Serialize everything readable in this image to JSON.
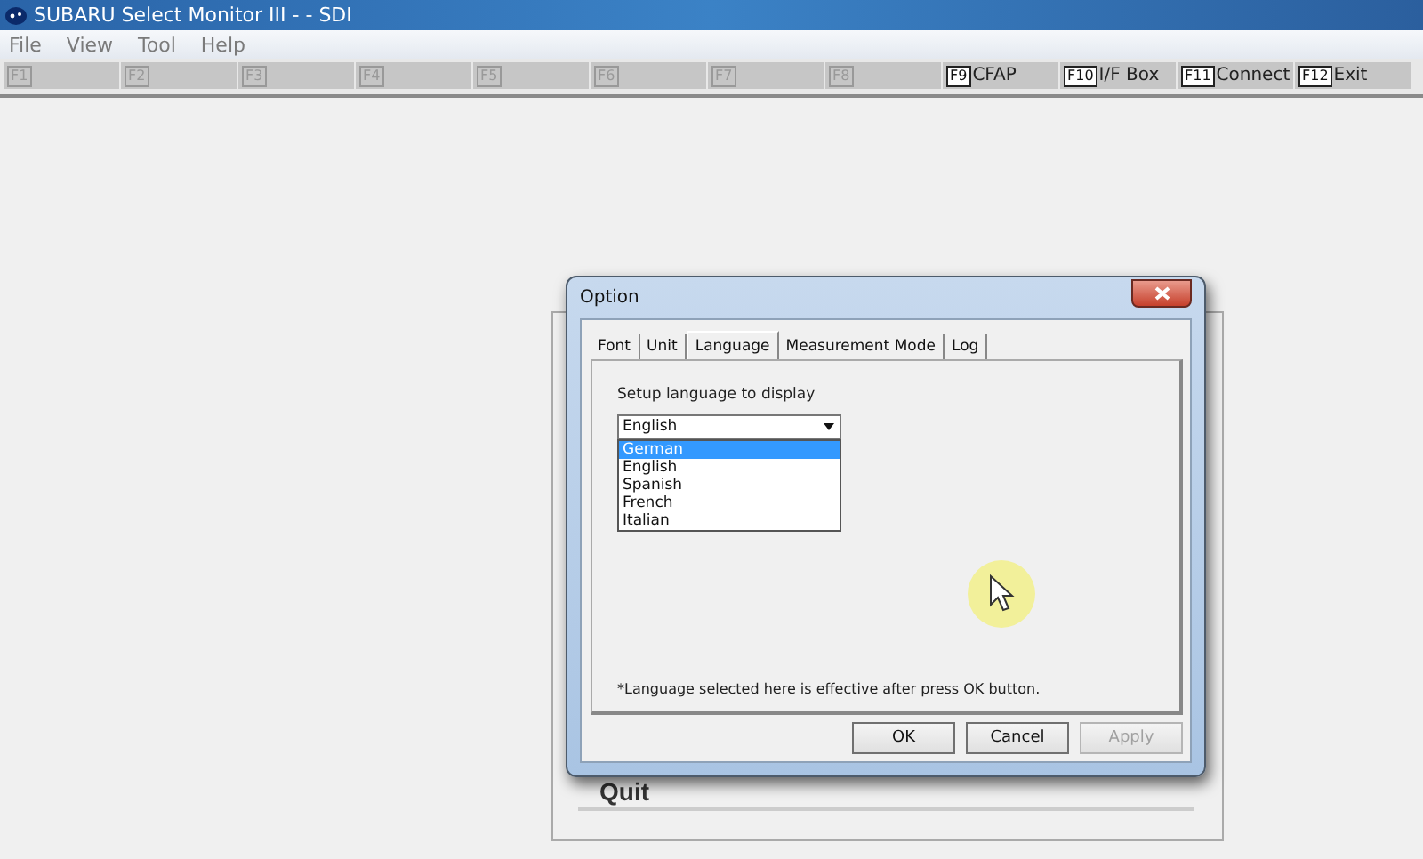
{
  "window": {
    "title": "SUBARU Select Monitor III -  - SDI"
  },
  "menu": [
    "File",
    "View",
    "Tool",
    "Help"
  ],
  "function_keys": [
    {
      "key": "F1",
      "disabled": true
    },
    {
      "key": "F2",
      "disabled": true
    },
    {
      "key": "F3",
      "disabled": true
    },
    {
      "key": "F4",
      "disabled": true
    },
    {
      "key": "F5",
      "disabled": true
    },
    {
      "key": "F6",
      "disabled": true
    },
    {
      "key": "F7",
      "disabled": true
    },
    {
      "key": "F8",
      "disabled": true
    },
    {
      "key": "F9",
      "label": "CFAP",
      "disabled": false
    },
    {
      "key": "F10",
      "label": "I/F Box",
      "disabled": false
    },
    {
      "key": "F11",
      "label": "Connect",
      "disabled": false
    },
    {
      "key": "F12",
      "label": "Exit",
      "disabled": false
    }
  ],
  "background_panel": {
    "button": "Quit"
  },
  "dialog": {
    "title": "Option",
    "tabs": [
      {
        "label": "Font",
        "selected": false
      },
      {
        "label": "Unit",
        "selected": false
      },
      {
        "label": "Language",
        "selected": true
      },
      {
        "label": "Measurement Mode",
        "selected": false
      },
      {
        "label": "Log",
        "selected": false
      }
    ],
    "prompt": "Setup language to display",
    "combo": {
      "value": "English",
      "expanded": true,
      "options": [
        {
          "label": "German",
          "highlighted": true
        },
        {
          "label": "English",
          "highlighted": false
        },
        {
          "label": "Spanish",
          "highlighted": false
        },
        {
          "label": "French",
          "highlighted": false
        },
        {
          "label": "Italian",
          "highlighted": false
        }
      ]
    },
    "note": "*Language selected here is effective after press OK button.",
    "buttons": [
      {
        "label": "OK",
        "disabled": false
      },
      {
        "label": "Cancel",
        "disabled": false
      },
      {
        "label": "Apply",
        "disabled": true
      }
    ]
  }
}
